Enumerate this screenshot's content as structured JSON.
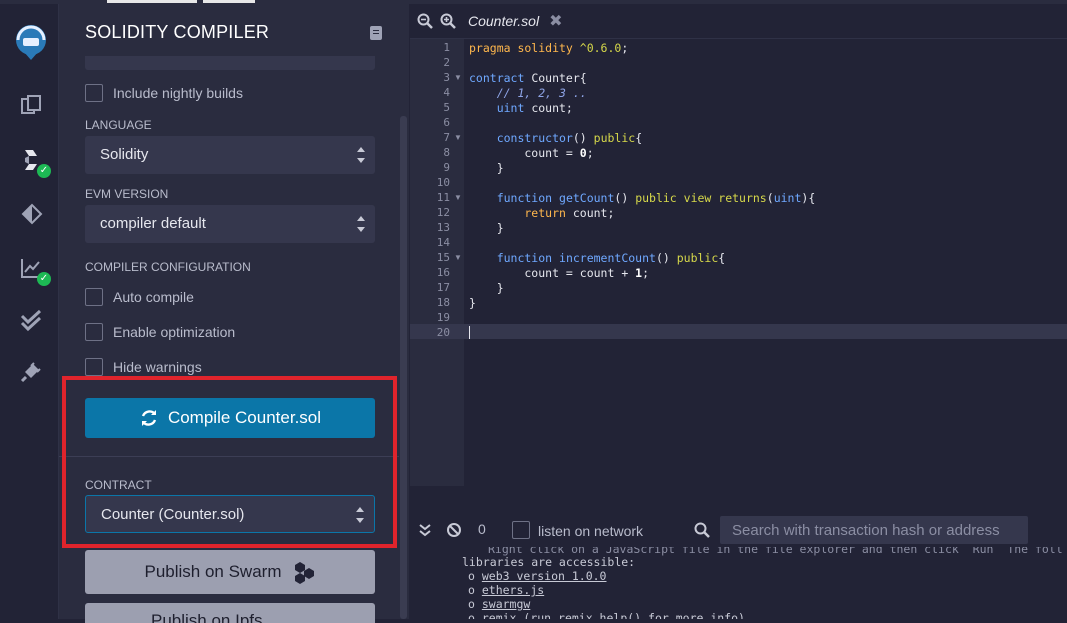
{
  "panel": {
    "title": "SOLIDITY COMPILER",
    "include_nightly": "Include nightly builds",
    "language_label": "LANGUAGE",
    "language_value": "Solidity",
    "evm_label": "EVM VERSION",
    "evm_value": "compiler default",
    "config_label": "COMPILER CONFIGURATION",
    "auto_compile": "Auto compile",
    "enable_optimization": "Enable optimization",
    "hide_warnings": "Hide warnings",
    "compile_button": "Compile Counter.sol",
    "contract_label": "CONTRACT",
    "contract_value": "Counter (Counter.sol)",
    "publish_swarm": "Publish on Swarm",
    "publish_ipfs": "Publish on Ipfs"
  },
  "editor": {
    "tab_name": "Counter.sol",
    "line_numbers": [
      "1",
      "2",
      "3",
      "4",
      "5",
      "6",
      "7",
      "8",
      "9",
      "10",
      "11",
      "12",
      "13",
      "14",
      "15",
      "16",
      "17",
      "18",
      "19",
      "20"
    ]
  },
  "terminal": {
    "count": "0",
    "listen_label": "listen on network",
    "search_placeholder": "Search with transaction hash or address",
    "line1": "Right click on a JavaScript file in the file explorer and then click `Run` The foll",
    "line2": "libraries are accessible:",
    "link1": "web3 version 1.0.0",
    "link2": "ethers.js",
    "link3": "swarmgw",
    "line_last": "remix (run remix.help() for more info)"
  },
  "colors": {
    "accent": "#0b76a8",
    "highlight_border": "#e0242c",
    "success": "#1db954"
  }
}
